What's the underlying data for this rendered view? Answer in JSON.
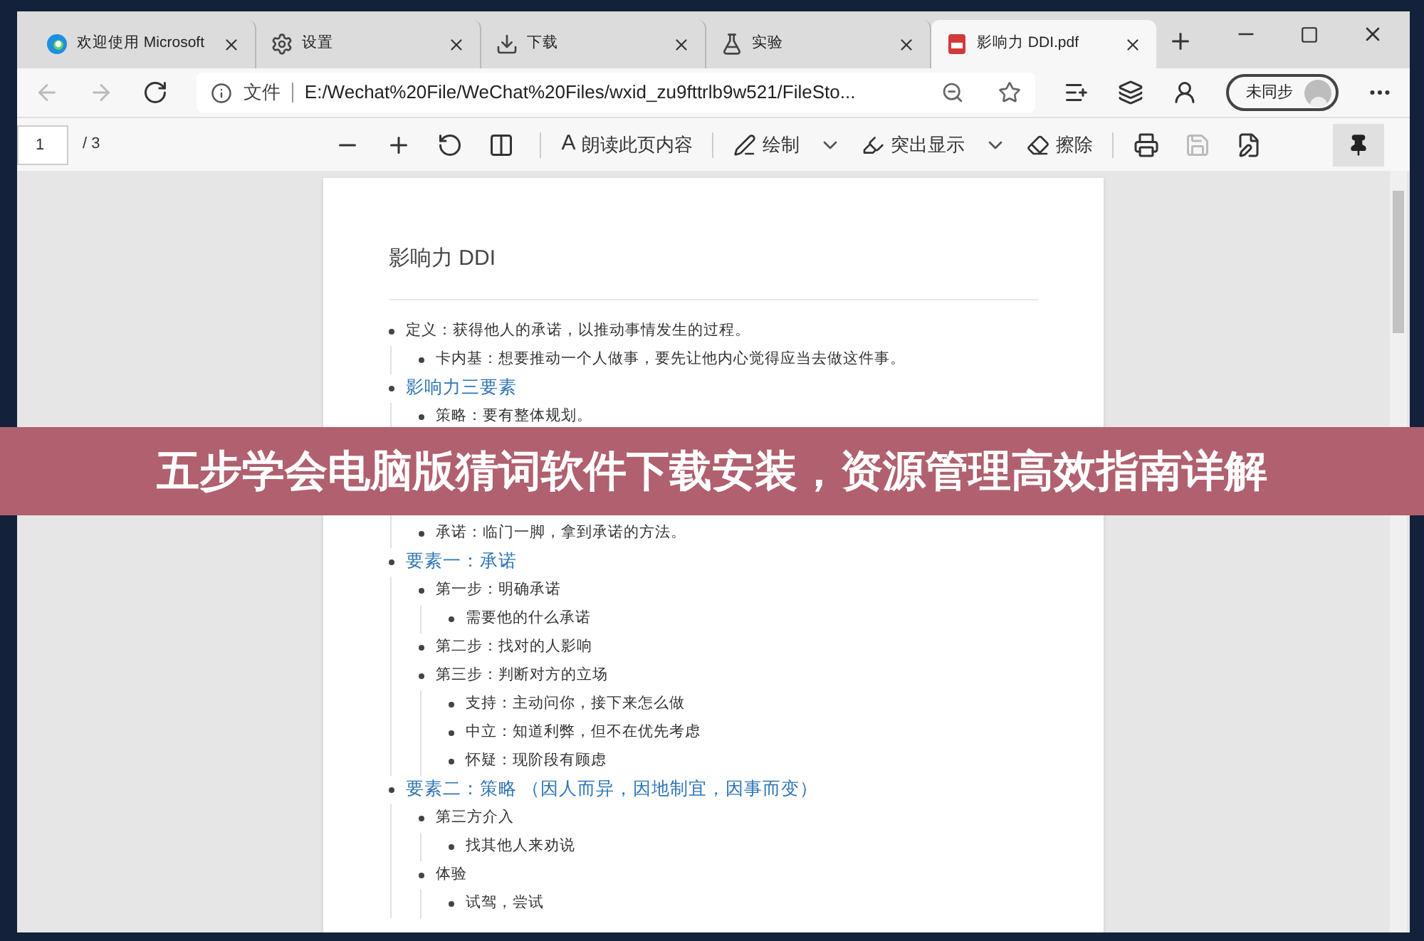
{
  "tabs": [
    {
      "label": "欢迎使用 Microsoft",
      "selected": false
    },
    {
      "label": "设置",
      "selected": false
    },
    {
      "label": "下载",
      "selected": false
    },
    {
      "label": "实验",
      "selected": false
    },
    {
      "label": "影响力 DDI.pdf",
      "selected": true
    }
  ],
  "address": {
    "prefix": "文件",
    "url": "E:/Wechat%20File/WeChat%20Files/wxid_zu9fttrlb9w521/FileSto..."
  },
  "sync_button": "未同步",
  "pdf_toolbar": {
    "page_number": "1",
    "page_count": "/ 3",
    "read_aloud_icon": "A",
    "read_aloud": "朗读此页内容",
    "draw": "绘制",
    "highlight": "突出显示",
    "erase": "擦除",
    "pinned": true
  },
  "document": {
    "title": "影响力 DDI",
    "items": [
      {
        "kind": "text",
        "text": "定义：获得他人的承诺，以推动事情发生的过程。",
        "children": [
          {
            "kind": "text",
            "text": "卡内基：想要推动一个人做事，要先让他内心觉得应当去做这件事。"
          }
        ]
      },
      {
        "kind": "heading",
        "text": "影响力三要素",
        "children": [
          {
            "kind": "text",
            "text": "策略：要有整体规划。"
          },
          {
            "kind": "gap"
          },
          {
            "kind": "text",
            "text": "承诺：临门一脚，拿到承诺的方法。"
          }
        ]
      },
      {
        "kind": "heading",
        "text": "要素一：承诺",
        "children": [
          {
            "kind": "text",
            "text": "第一步：明确承诺",
            "children": [
              {
                "kind": "text",
                "text": "需要他的什么承诺"
              }
            ]
          },
          {
            "kind": "text",
            "text": "第二步：找对的人影响"
          },
          {
            "kind": "text",
            "text": "第三步：判断对方的立场",
            "children": [
              {
                "kind": "text",
                "text": "支持：主动问你，接下来怎么做"
              },
              {
                "kind": "text",
                "text": "中立：知道利弊，但不在优先考虑"
              },
              {
                "kind": "text",
                "text": "怀疑：现阶段有顾虑"
              }
            ]
          }
        ]
      },
      {
        "kind": "heading",
        "text": "要素二：策略 （因人而异，因地制宜，因事而变）",
        "children": [
          {
            "kind": "text",
            "text": "第三方介入",
            "children": [
              {
                "kind": "text",
                "text": "找其他人来劝说"
              }
            ]
          },
          {
            "kind": "text",
            "text": "体验",
            "children": [
              {
                "kind": "text",
                "text": "试驾，尝试"
              }
            ]
          }
        ]
      }
    ]
  },
  "banner": "五步学会电脑版猜词软件下载安装，资源管理高效指南详解"
}
